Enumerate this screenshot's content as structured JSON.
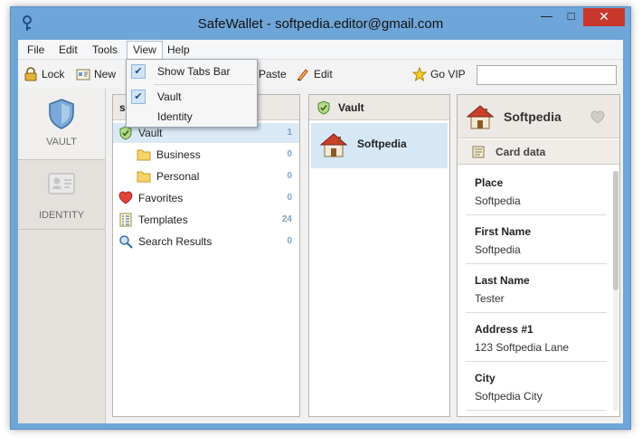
{
  "window": {
    "title": "SafeWallet - softpedia.editor@gmail.com"
  },
  "menu": {
    "file": "File",
    "edit": "Edit",
    "tools": "Tools",
    "view": "View",
    "help": "Help"
  },
  "view_menu": {
    "show_tabs_bar": "Show Tabs Bar",
    "vault": "Vault",
    "identity": "Identity"
  },
  "toolbar": {
    "lock": "Lock",
    "new": "New",
    "paste": "Paste",
    "edit": "Edit",
    "go_vip": "Go VIP",
    "search_value": ""
  },
  "sidebar": {
    "vault": "VAULT",
    "identity": "IDENTITY"
  },
  "tree": {
    "header": "sof",
    "items": [
      {
        "label": "Vault",
        "count": "1"
      },
      {
        "label": "Business",
        "count": "0"
      },
      {
        "label": "Personal",
        "count": "0"
      },
      {
        "label": "Favorites",
        "count": "0"
      },
      {
        "label": "Templates",
        "count": "24"
      },
      {
        "label": "Search Results",
        "count": "0"
      }
    ]
  },
  "list": {
    "header": "Vault",
    "entries": [
      {
        "title": "Softpedia"
      }
    ]
  },
  "detail": {
    "title": "Softpedia",
    "section": "Card data",
    "fields": [
      {
        "label": "Place",
        "value": "Softpedia"
      },
      {
        "label": "First Name",
        "value": "Softpedia"
      },
      {
        "label": "Last Name",
        "value": "Tester"
      },
      {
        "label": "Address #1",
        "value": "123 Softpedia Lane"
      },
      {
        "label": "City",
        "value": "Softpedia City"
      }
    ]
  },
  "colors": {
    "titlebar": "#6fa6d9",
    "close": "#c7372b",
    "selection": "#d9e9f6",
    "count": "#7ea2c2"
  }
}
